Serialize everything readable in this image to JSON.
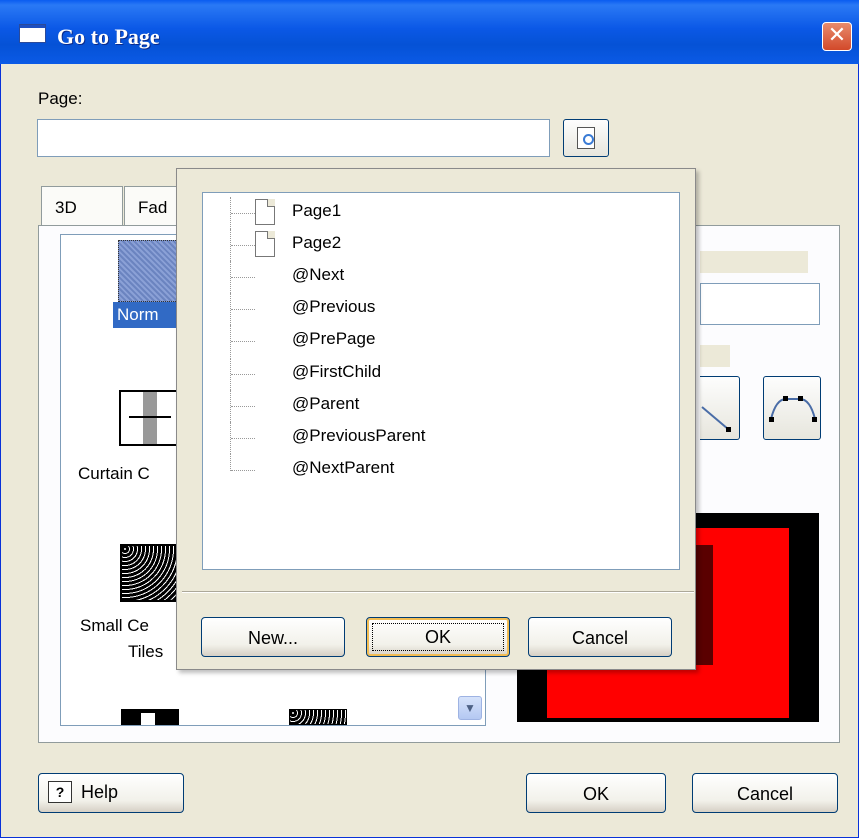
{
  "window": {
    "title": "Go to Page",
    "close_glyph": "✕"
  },
  "page_field": {
    "label": "Page:",
    "value": "",
    "browse_icon": "browse-page-icon"
  },
  "tabs": [
    {
      "label": "3D"
    },
    {
      "label": "Fad"
    }
  ],
  "gallery": {
    "items": [
      {
        "label": "Norm"
      },
      {
        "label": "Curtain C"
      },
      {
        "label_line1": "Small Ce",
        "label_line2": "Tiles"
      }
    ]
  },
  "popup": {
    "tree": [
      {
        "label": "Page1",
        "icon": "page-icon"
      },
      {
        "label": "Page2",
        "icon": "page-icon"
      },
      {
        "label": "@Next"
      },
      {
        "label": "@Previous"
      },
      {
        "label": "@PrePage"
      },
      {
        "label": "@FirstChild"
      },
      {
        "label": "@Parent"
      },
      {
        "label": "@PreviousParent"
      },
      {
        "label": "@NextParent"
      }
    ],
    "buttons": {
      "new": "New...",
      "ok": "OK",
      "cancel": "Cancel"
    }
  },
  "footer": {
    "help": "Help",
    "help_glyph": "?",
    "ok": "OK",
    "cancel": "Cancel"
  },
  "colors": {
    "titlebar": "#0552d6",
    "selection": "#316ac5",
    "preview_outer": "#000000",
    "preview_inner": "#ff0000"
  }
}
